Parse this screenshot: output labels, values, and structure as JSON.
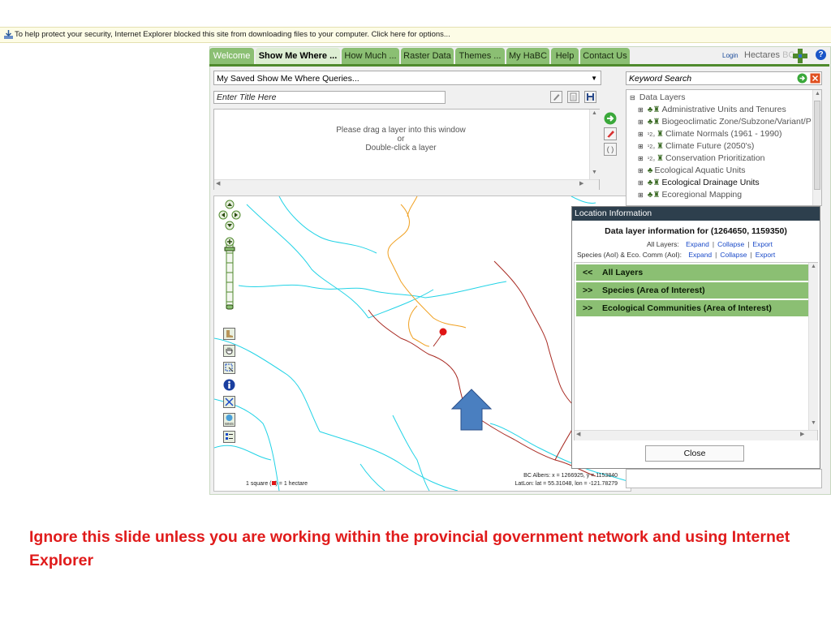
{
  "ie_bar": {
    "text": "To help protect your security, Internet Explorer blocked this site from downloading files to your computer. Click here for options..."
  },
  "tabs": [
    "Welcome",
    "Show Me Where ...",
    "How Much ...",
    "Raster Data",
    "Themes ...",
    "My HaBC",
    "Help",
    "Contact Us"
  ],
  "active_tab": "Show Me Where ...",
  "header": {
    "login": "Login",
    "hectares": "Hectares",
    "bc": "BC",
    "help": "?"
  },
  "queries": {
    "selected": "My Saved Show Me Where Queries..."
  },
  "title_input": {
    "value": "Enter Title Here"
  },
  "drop_zone": {
    "line1": "Please drag a layer into this window",
    "line2": "or",
    "line3": "Double-click a layer"
  },
  "keyword": {
    "value": "Keyword Search"
  },
  "layers": {
    "root": "Data Layers",
    "items": [
      "Administrative Units and Tenures",
      "Biogeoclimatic Zone/Subzone/Variant/P",
      "Climate Normals (1961 - 1990)",
      "Climate Future (2050's)",
      "Conservation Prioritization",
      "Ecological Aquatic Units",
      "Ecological Drainage Units",
      "Ecoregional Mapping"
    ]
  },
  "map": {
    "scale_label_prefix": "1 square (",
    "scale_label_suffix": ") = 1 hectare",
    "coords_albers": "BC Albers: x = 1266925, y = 1153840",
    "coords_latlon": "LatLon: lat = 55.31048, lon = -121.78279"
  },
  "location_info": {
    "header": "Location Information",
    "title": "Data layer information for (1264650, 1159350)",
    "all_layers_label": "All Layers:",
    "species_label": "Species (AoI) & Eco. Comm (AoI):",
    "expand": "Expand",
    "collapse": "Collapse",
    "export": "Export",
    "sections": [
      {
        "chevron": "<<",
        "label": "All Layers"
      },
      {
        "chevron": ">>",
        "label": "Species (Area of Interest)"
      },
      {
        "chevron": ">>",
        "label": "Ecological Communities (Area of Interest)"
      }
    ],
    "close": "Close"
  },
  "notice": "Ignore this slide unless you are working within the provincial government network and using Internet Explorer",
  "colors": {
    "tab_green": "#8bbf73",
    "tab_line": "#4f8a2d",
    "popup_header": "#2d3f4d",
    "notice_red": "#e01b1b",
    "river": "#22d3e6",
    "road": "#f0a020",
    "trail": "#a02020",
    "arrow": "#4a7fc0"
  }
}
